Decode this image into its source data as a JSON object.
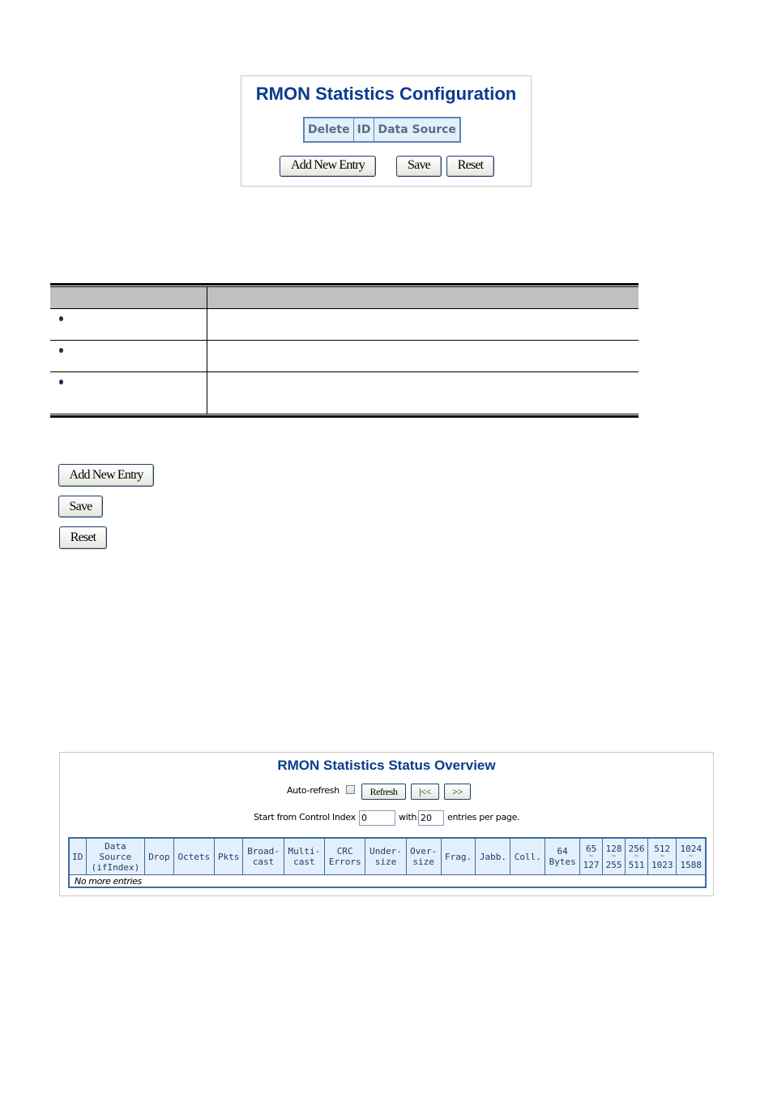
{
  "config_panel": {
    "title": "RMON Statistics Configuration",
    "table_headers": [
      "Delete",
      "ID",
      "Data Source"
    ],
    "buttons": {
      "add_new_entry": "Add New Entry",
      "save": "Save",
      "reset": "Reset"
    }
  },
  "description_table": {
    "rows": [
      {
        "bullet": true
      },
      {
        "bullet": true
      },
      {
        "bullet": true
      }
    ]
  },
  "button_legend": {
    "add_new_entry": "Add New Entry",
    "save": "Save",
    "reset": "Reset"
  },
  "status_panel": {
    "title": "RMON Statistics Status Overview",
    "auto_refresh_label": "Auto-refresh",
    "auto_refresh_checked": false,
    "refresh_button": "Refresh",
    "first_page_button": "|<<",
    "next_page_button": ">>",
    "start_from_label": "Start from Control Index",
    "start_index_value": "0",
    "with_label": "with",
    "entries_per_page_value": "20",
    "entries_per_page_label": "entries per page.",
    "columns": [
      {
        "line1": "ID"
      },
      {
        "line1": "Data",
        "line2": "Source",
        "line3": "(ifIndex)"
      },
      {
        "line1": "Drop"
      },
      {
        "line1": "Octets"
      },
      {
        "line1": "Pkts"
      },
      {
        "line1": "Broad-",
        "line2": "cast"
      },
      {
        "line1": "Multi-",
        "line2": "cast"
      },
      {
        "line1": "CRC",
        "line2": "Errors"
      },
      {
        "line1": "Under-",
        "line2": "size"
      },
      {
        "line1": "Over-",
        "line2": "size"
      },
      {
        "line1": "Frag."
      },
      {
        "line1": "Jabb."
      },
      {
        "line1": "Coll."
      },
      {
        "line1": "64",
        "line2": "Bytes"
      },
      {
        "line1": "65",
        "tilde": "~",
        "line3": "127"
      },
      {
        "line1": "128",
        "tilde": "~",
        "line3": "255"
      },
      {
        "line1": "256",
        "tilde": "~",
        "line3": "511"
      },
      {
        "line1": "512",
        "tilde": "~",
        "line3": "1023"
      },
      {
        "line1": "1024",
        "tilde": "~",
        "line3": "1588"
      }
    ],
    "empty_message": "No more entries"
  }
}
